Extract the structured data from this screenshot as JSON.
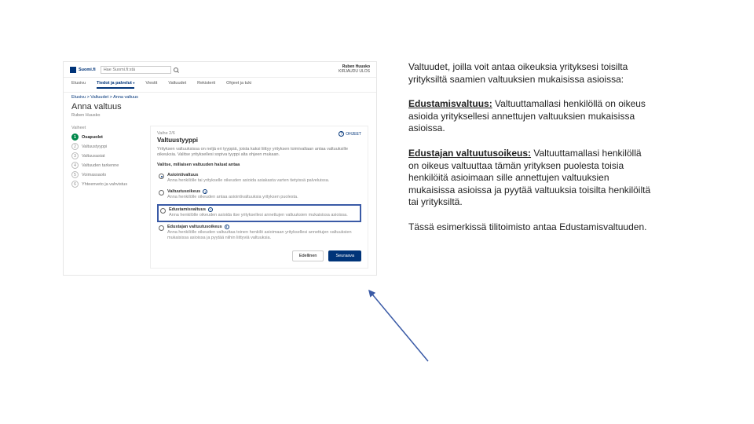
{
  "header": {
    "logo": "Suomi.fi",
    "search_placeholder": "Hae Suomi.fi:stä",
    "user_name": "Ruben Huusko",
    "user_sub": "KIRJAUDU ULOS"
  },
  "nav": [
    "Etusivu",
    "Tiedot ja palvelut",
    "Viestit",
    "Valtuudet",
    "Rekisterit",
    "Ohjeet ja tuki"
  ],
  "breadcrumb": "Etusivu > Valtuudet > Anna valtuus",
  "page_title": "Anna valtuus",
  "page_user": "Ruben Huusko",
  "steps_title": "Vaiheet",
  "steps": [
    {
      "n": "1",
      "label": "Osapuolet",
      "current": true
    },
    {
      "n": "2",
      "label": "Valtuustyyppi"
    },
    {
      "n": "3",
      "label": "Valtuusasiat"
    },
    {
      "n": "4",
      "label": "Valtuuden tarkenne"
    },
    {
      "n": "5",
      "label": "Voimassaolo"
    },
    {
      "n": "6",
      "label": "Yhteenveto ja vahvistus"
    }
  ],
  "panel": {
    "vaihe": "Vaihe 2/6",
    "title": "Valtuustyyppi",
    "help": "OHJEET",
    "desc": "Yrityksen valtuuksissa on neljä eri tyyppiä, joista kaksi liittyy yrityksen toimivaltaan antaa valtuuksille oikeuksia. Valitse yrityksellesi sopiva tyyppi alta ohjeen mukaan.",
    "question": "Valitse, millaisen valtuuden haluat antaa",
    "options": [
      {
        "label": "Asiointivaltuus",
        "exp": "Anna henkilölle tai yritykselle oikeuden asioida asiakasta varten tietyissä palveluissa.",
        "selected": true
      },
      {
        "label": "Valtuutusoikeus",
        "exp": "Anna henkilölle oikeuden antaa asiointivaltuuksia yrityksen puolesta.",
        "info": true
      },
      {
        "label": "Edustamisvaltuus",
        "exp": "Anna henkilölle oikeuden asioida itse yrityksellesi annettujen valtuuksien mukaisissa asioissa.",
        "info": true,
        "highlight": true
      },
      {
        "label": "Edustajan valtuutusoikeus",
        "exp": "Anna henkilölle oikeuden valtuuttaa toinen henkilö asioimaan yrityksellesi annettujen valtuuksien mukaisissa asioissa ja pyytää niihin liittyviä valtuuksia.",
        "info": true
      }
    ],
    "btn_back": "Edellinen",
    "btn_next": "Seuraava"
  },
  "notes": {
    "p1": "Valtuudet, joilla voit antaa oikeuksia yrityksesi toisilta yrityksiltä saamien valtuuksien mukaisissa asioissa:",
    "t2": "Edustamisvaltuus:",
    "p2": " Valtuuttamallasi henkilöllä on oikeus asioida yrityksellesi annettujen valtuuksien mukaisissa asioissa.",
    "t3": "Edustajan valtuutusoikeus:",
    "p3": " Valtuuttamallasi henkilöllä on oikeus valtuuttaa tämän yrityksen puolesta toisia henkilöitä asioimaan sille annettujen valtuuksien mukaisissa asioissa ja pyytää valtuuksia toisilta henkilöiltä tai yrityksiltä.",
    "p4": "Tässä esimerkissä tilitoimisto antaa Edustamisvaltuuden."
  }
}
